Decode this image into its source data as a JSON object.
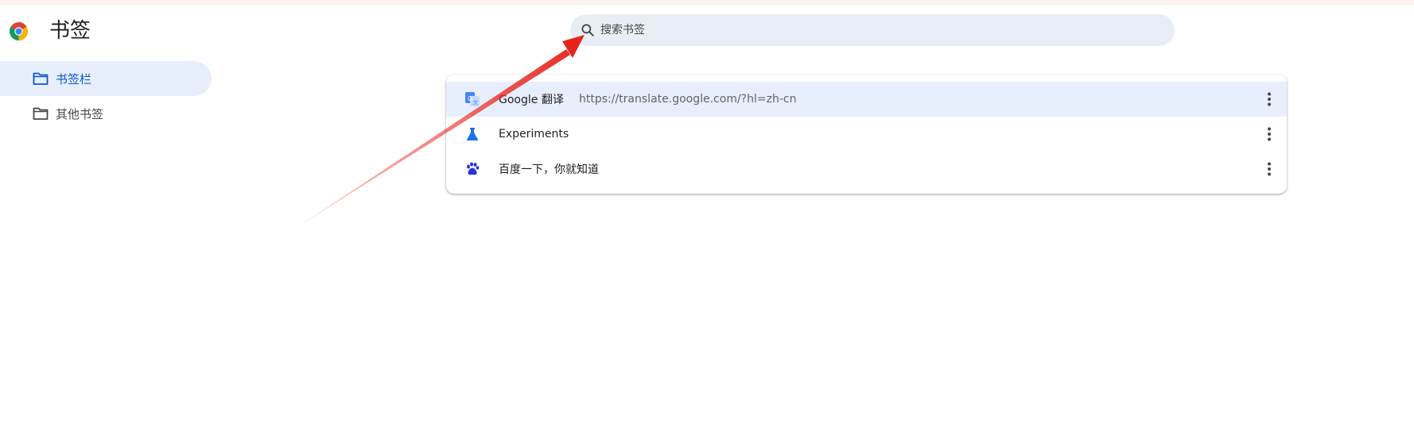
{
  "header": {
    "title": "书签"
  },
  "search": {
    "placeholder": "搜索书签",
    "value": ""
  },
  "sidebar": {
    "items": [
      {
        "label": "书签栏",
        "active": true
      },
      {
        "label": "其他书签",
        "active": false
      }
    ]
  },
  "bookmarks": [
    {
      "title": "Google 翻译",
      "url": "https://translate.google.com/?hl=zh-cn",
      "icon": "google-translate-icon",
      "selected": true
    },
    {
      "title": "Experiments",
      "url": "",
      "icon": "flask-icon",
      "selected": false
    },
    {
      "title": "百度一下，你就知道",
      "url": "",
      "icon": "baidu-paw-icon",
      "selected": false
    }
  ],
  "colors": {
    "accent": "#0b57d0",
    "selected_bg": "#e8effc",
    "search_bg": "#e9eef6",
    "annotation": "#e8231a"
  }
}
